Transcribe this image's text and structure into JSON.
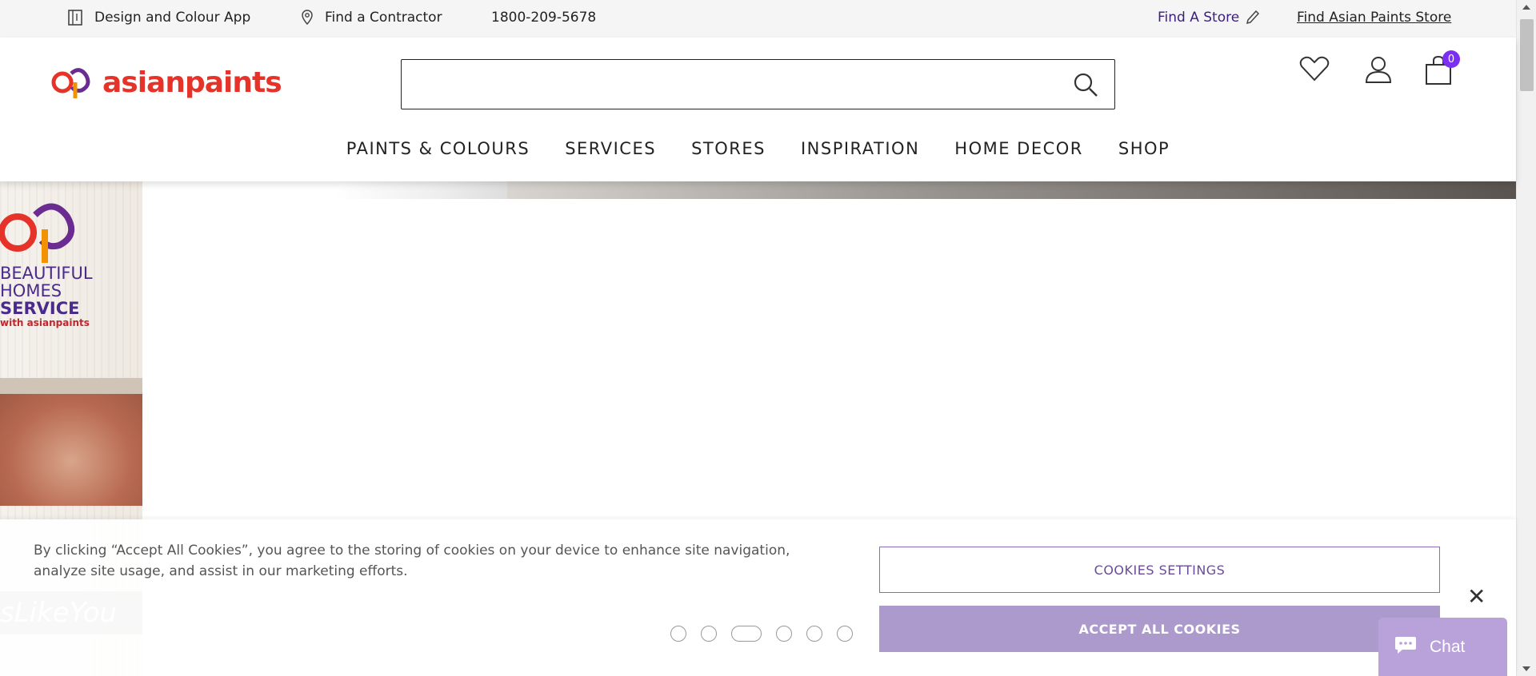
{
  "topbar": {
    "app_label": "Design and Colour App",
    "contractor_label": "Find a Contractor",
    "phone": "1800-209-5678",
    "find_store_label": "Find A Store",
    "find_ap_store_label": "Find Asian Paints Store"
  },
  "header": {
    "logo_text": "asianpaints",
    "search_placeholder": "",
    "cart_count": "0",
    "nav": [
      "PAINTS & COLOURS",
      "SERVICES",
      "STORES",
      "INSPIRATION",
      "HOME DECOR",
      "SHOP"
    ]
  },
  "hero": {
    "brand_line1": "BEAUTIFUL",
    "brand_line2a": "HOMES ",
    "brand_line2b": "SERVICE",
    "brand_line3": "with asianpaints",
    "hashtag": "sLikeYou"
  },
  "carousel": {
    "slide_count": 6,
    "active_index": 2
  },
  "cookie": {
    "text": "By clicking “Accept All Cookies”, you agree to the storing of cookies on your device to enhance site navigation, analyze site usage, and assist in our marketing efforts.",
    "settings_label": "COOKIES SETTINGS",
    "accept_label": "ACCEPT ALL COOKIES",
    "close_label": "✕"
  },
  "chat": {
    "label": "Chat"
  },
  "colors": {
    "brand_red": "#e6332a",
    "brand_purple": "#3b1f7a",
    "badge": "#7b2ff0",
    "accept_bg": "#ab9acb"
  },
  "icons": [
    "app-icon",
    "location-pin-icon",
    "pencil-icon",
    "search-icon",
    "heart-icon",
    "user-icon",
    "cart-icon",
    "chat-bubble-icon"
  ]
}
